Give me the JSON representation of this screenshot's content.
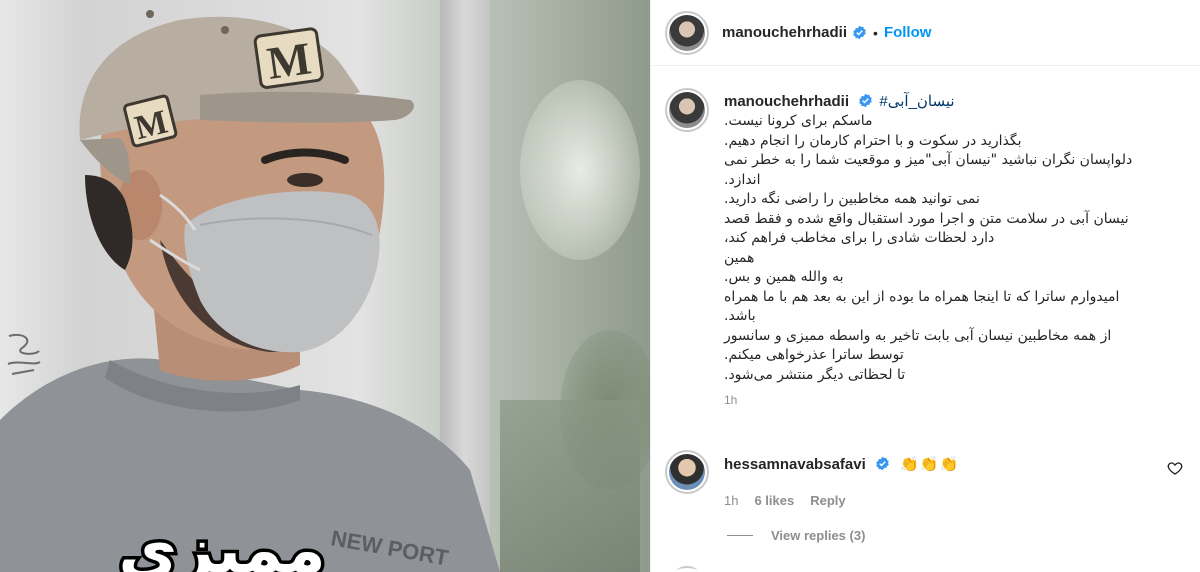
{
  "photo": {
    "overlay_text": "ممیزی",
    "cap_letter": "M",
    "shirt_text": "NEW PORT"
  },
  "post": {
    "author": {
      "username": "manouchehrhadii",
      "verified": true
    },
    "follow_label": "Follow",
    "dot": "•",
    "caption": {
      "hashtag": "#نیسان_آبی",
      "lines": [
        "ماسکم برای کرونا نیست.",
        "بگذارید در سکوت و با احترام کارمان را انجام دهیم.",
        "دلواپسان نگران نباشید \"نیسان آبی\"میز و موقعیت شما را به خطر نمی",
        "اندازد.",
        "نمی توانید همه مخاطبین را راضی نگه دارید.",
        "نیسان آبی در سلامت متن و اجرا مورد استقبال واقع شده و فقط قصد",
        "دارد لحظات شادی را برای مخاطب فراهم کند،",
        "همین",
        "به والله همین و بس.",
        "امیدوارم ساترا که تا اینجا همراه ما بوده از این به بعد هم با ما همراه",
        "باشد.",
        "از همه مخاطبین نیسان آبی بابت تاخیر به واسطه ممیزی و سانسور",
        "توسط ساترا عذرخواهی میکنم.",
        "تا لحظاتی دیگر منتشر می‌شود."
      ],
      "time": "1h"
    },
    "comments": [
      {
        "username": "hessamnavabsafavi",
        "verified": true,
        "text": "👏👏👏",
        "time": "1h",
        "likes": "6 likes",
        "reply_label": "Reply",
        "view_replies": "View replies (3)"
      }
    ]
  },
  "colors": {
    "accent": "#0095f6",
    "verified": "#3897f0",
    "hashtag": "#00376b",
    "muted": "#8e8e8e"
  },
  "icons": [
    "verified-badge-icon",
    "heart-icon",
    "signature-watermark"
  ]
}
